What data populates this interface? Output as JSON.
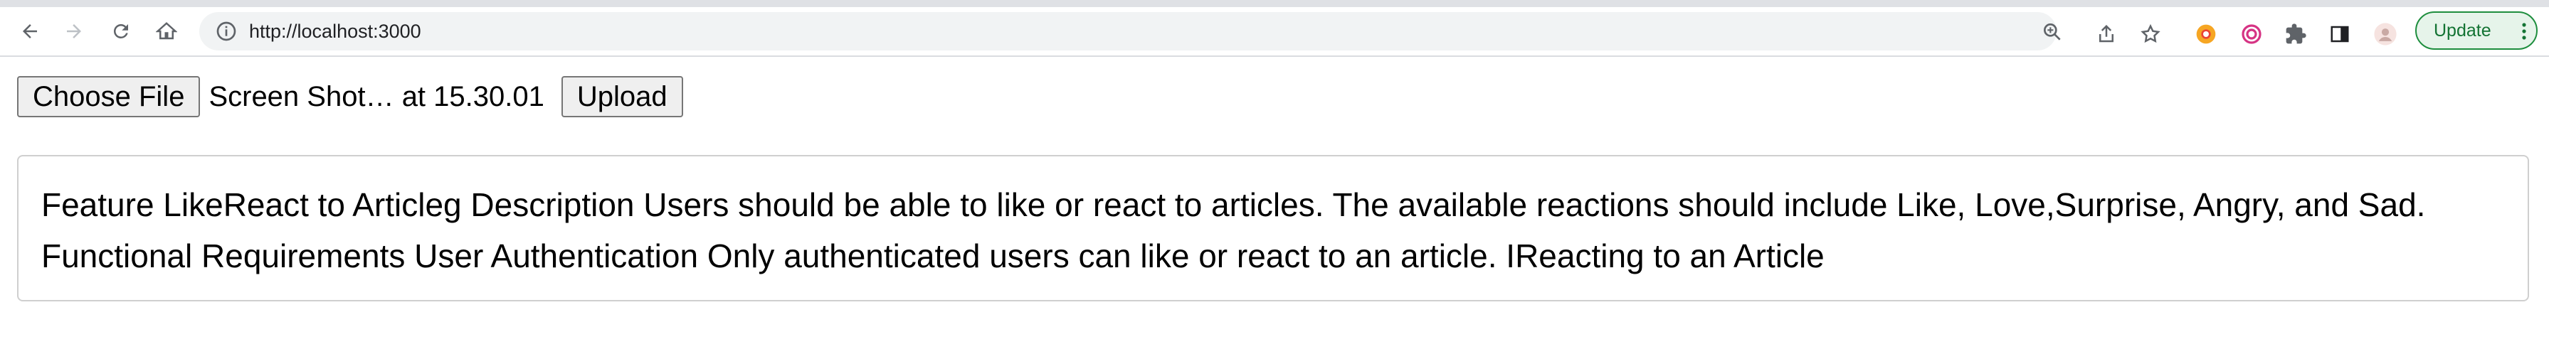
{
  "browser": {
    "url": "http://localhost:3000",
    "update_label": "Update"
  },
  "icons": {
    "back": "arrow-left-icon",
    "forward": "arrow-right-icon",
    "reload": "reload-icon",
    "home": "home-icon",
    "info": "info-icon",
    "zoom": "zoom-icon",
    "share": "share-icon",
    "bookmark": "star-icon",
    "extension1": "chrome-extension-icon",
    "extension2": "target-extension-icon",
    "extensions": "puzzle-icon",
    "side_panel": "side-panel-icon",
    "profile": "avatar-icon",
    "menu": "more-vert-icon"
  },
  "form": {
    "choose_file_label": "Choose File",
    "file_name": "Screen Shot… at 15.30.01",
    "upload_label": "Upload"
  },
  "output_text": " Feature LikeReact to Articleg Description Users should be able to like or react to articles. The available reactions should include Like, Love,Surprise, Angry, and Sad. Functional Requirements User Authentication Only authenticated users can like or react to an article. IReacting to an Article",
  "colors": {
    "accent_green": "#1e8e3e",
    "omnibox_bg": "#f1f3f4"
  }
}
